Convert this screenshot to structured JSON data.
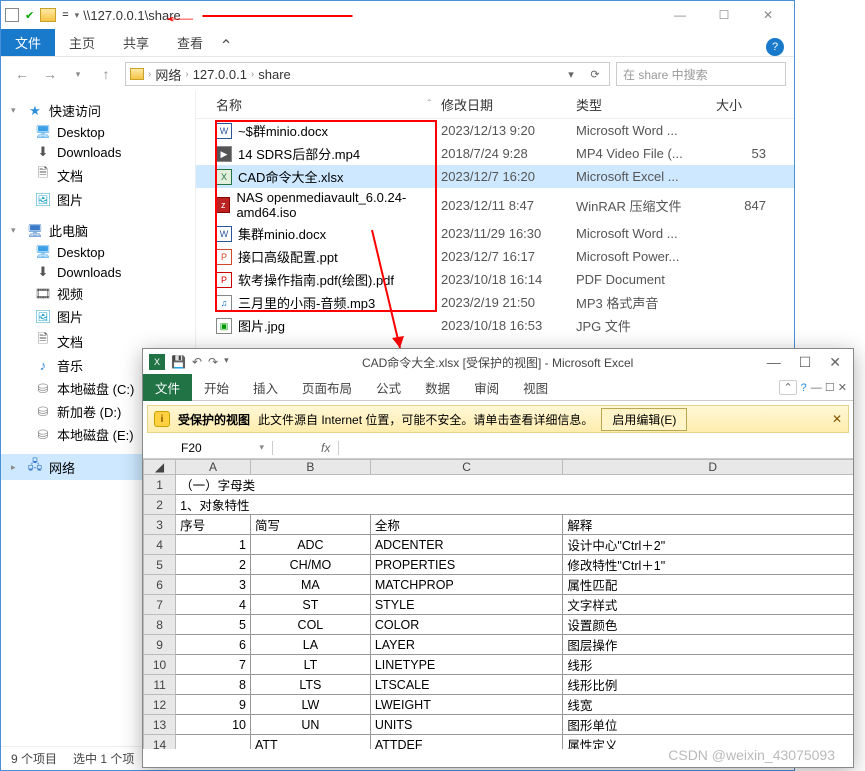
{
  "explorer": {
    "title_path": "\\\\127.0.0.1\\share",
    "ribbon": {
      "file": "文件",
      "home": "主页",
      "share": "共享",
      "view": "查看"
    },
    "breadcrumb": [
      "网络",
      "127.0.0.1",
      "share"
    ],
    "search_placeholder": "在 share 中搜索",
    "sidebar": {
      "quick": "快速访问",
      "desktop": "Desktop",
      "downloads": "Downloads",
      "docs": "文档",
      "pics": "图片",
      "pc": "此电脑",
      "video": "视频",
      "music": "音乐",
      "driveC": "本地磁盘 (C:)",
      "driveD": "新加卷 (D:)",
      "driveE": "本地磁盘 (E:)",
      "network": "网络"
    },
    "columns": {
      "name": "名称",
      "date": "修改日期",
      "type": "类型",
      "size": "大小"
    },
    "files": [
      {
        "icon": "wd",
        "name": "~$群minio.docx",
        "date": "2023/12/13 9:20",
        "type": "Microsoft Word ...",
        "size": ""
      },
      {
        "icon": "mp4",
        "name": "14 SDRS后部分.mp4",
        "date": "2018/7/24 9:28",
        "type": "MP4 Video File (...",
        "size": "53"
      },
      {
        "icon": "xl",
        "name": "CAD命令大全.xlsx",
        "date": "2023/12/7 16:20",
        "type": "Microsoft Excel ...",
        "size": "",
        "selected": true
      },
      {
        "icon": "iso",
        "name": "NAS openmediavault_6.0.24-amd64.iso",
        "date": "2023/12/11 8:47",
        "type": "WinRAR 压缩文件",
        "size": "847"
      },
      {
        "icon": "wd",
        "name": "集群minio.docx",
        "date": "2023/11/29 16:30",
        "type": "Microsoft Word ...",
        "size": ""
      },
      {
        "icon": "pp",
        "name": "接口高级配置.ppt",
        "date": "2023/12/7 16:17",
        "type": "Microsoft Power...",
        "size": ""
      },
      {
        "icon": "pdf",
        "name": "软考操作指南.pdf(绘图).pdf",
        "date": "2023/10/18 16:14",
        "type": "PDF Document",
        "size": ""
      },
      {
        "icon": "mp3",
        "name": "三月里的小雨-音频.mp3",
        "date": "2023/2/19 21:50",
        "type": "MP3 格式声音",
        "size": ""
      },
      {
        "icon": "jpg",
        "name": "图片.jpg",
        "date": "2023/10/18 16:53",
        "type": "JPG 文件",
        "size": ""
      }
    ],
    "status": {
      "count": "9 个项目",
      "selected": "选中 1 个项"
    }
  },
  "excel": {
    "title": "CAD命令大全.xlsx  [受保护的视图] - Microsoft Excel",
    "ribbon": {
      "file": "文件",
      "home": "开始",
      "insert": "插入",
      "layout": "页面布局",
      "formula": "公式",
      "data": "数据",
      "review": "审阅",
      "view": "视图"
    },
    "warn": {
      "label": "受保护的视图",
      "msg": "此文件源自 Internet 位置，可能不安全。请单击查看详细信息。",
      "btn": "启用编辑(E)"
    },
    "namebox": "F20",
    "cols": [
      "A",
      "B",
      "C",
      "D"
    ],
    "rows": [
      {
        "n": "1",
        "cells": [
          "（一）字母类",
          "",
          "",
          ""
        ],
        "merge_all": true
      },
      {
        "n": "2",
        "cells": [
          "1、对象特性",
          "",
          "",
          ""
        ],
        "merge_all": true
      },
      {
        "n": "3",
        "cells": [
          "序号",
          "简写",
          "全称",
          "解释"
        ]
      },
      {
        "n": "4",
        "cells": [
          "1",
          "ADC",
          "ADCENTER",
          "设计中心\"Ctrl＋2\""
        ],
        "num": true
      },
      {
        "n": "5",
        "cells": [
          "2",
          "CH/MO",
          "PROPERTIES",
          "修改特性\"Ctrl＋1\""
        ],
        "num": true
      },
      {
        "n": "6",
        "cells": [
          "3",
          "MA",
          "MATCHPROP",
          "属性匹配"
        ],
        "num": true
      },
      {
        "n": "7",
        "cells": [
          "4",
          "ST",
          "STYLE",
          "文字样式"
        ],
        "num": true
      },
      {
        "n": "8",
        "cells": [
          "5",
          "COL",
          "COLOR",
          "设置颜色"
        ],
        "num": true
      },
      {
        "n": "9",
        "cells": [
          "6",
          "LA",
          "LAYER",
          "图层操作"
        ],
        "num": true
      },
      {
        "n": "10",
        "cells": [
          "7",
          "LT",
          "LINETYPE",
          "线形"
        ],
        "num": true
      },
      {
        "n": "11",
        "cells": [
          "8",
          "LTS",
          "LTSCALE",
          "线形比例"
        ],
        "num": true
      },
      {
        "n": "12",
        "cells": [
          "9",
          "LW",
          "LWEIGHT",
          "线宽"
        ],
        "num": true
      },
      {
        "n": "13",
        "cells": [
          "10",
          "UN",
          "UNITS",
          "图形单位"
        ],
        "num": true
      },
      {
        "n": "14",
        "cells": [
          "",
          "ATT",
          "ATTDEF",
          "属性定义"
        ]
      }
    ]
  },
  "watermark": "CSDN @weixin_43075093"
}
